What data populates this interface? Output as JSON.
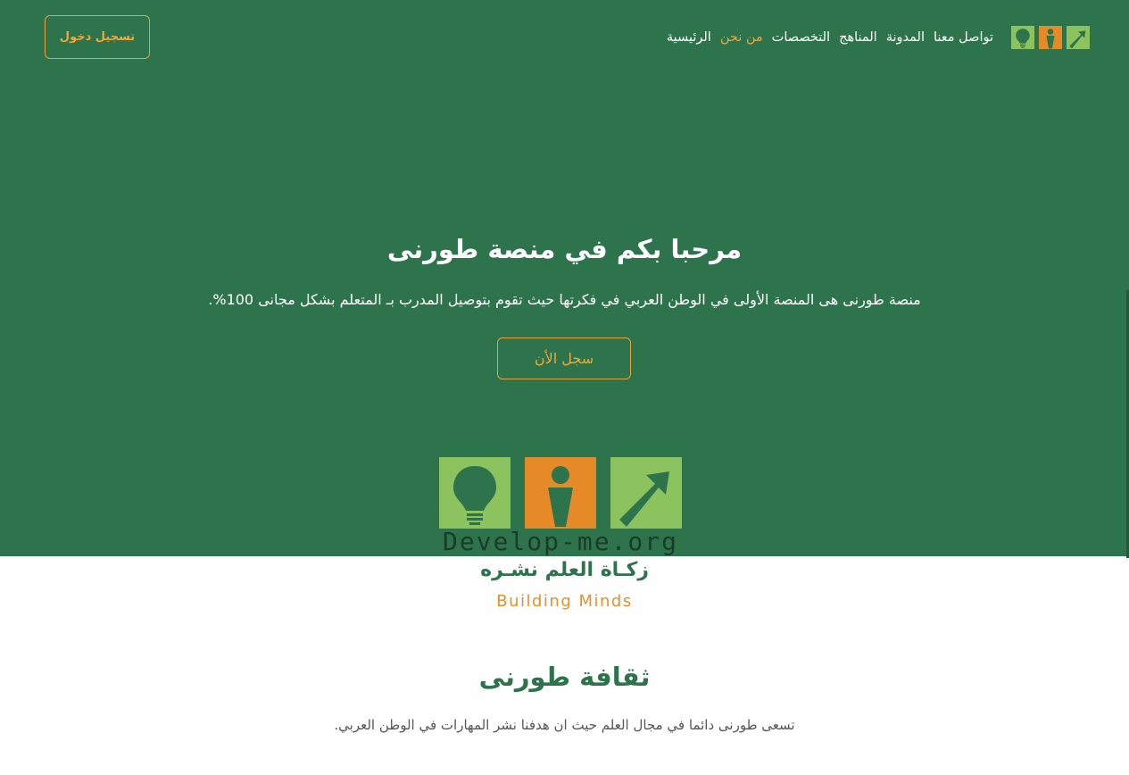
{
  "header": {
    "login_label": "تسجيل دخول",
    "nav": [
      {
        "label": "الرئيسية",
        "active": false
      },
      {
        "label": "من نحن",
        "active": true
      },
      {
        "label": "التخصصات",
        "active": false
      },
      {
        "label": "المناهج",
        "active": false
      },
      {
        "label": "المدونة",
        "active": false
      },
      {
        "label": "تواصل معنا",
        "active": false
      }
    ],
    "logo_icons": [
      "lightbulb-icon",
      "person-icon",
      "arrow-up-right-icon"
    ]
  },
  "hero": {
    "title": "مرحبا بكم في منصة طورنى",
    "subtitle": "منصة طورنى هى المنصة الأولى في الوطن العربي في فكرتها حيث تقوم بتوصيل المدرب بـ المتعلم بشكل مجانى 100%.",
    "cta_label": "سجل الأن"
  },
  "brand": {
    "logo_text": "Develop-me.org",
    "tagline_ar": "زكـاة العلم نشـره",
    "tagline_en": "Building Minds"
  },
  "culture": {
    "title": "ثقافة طورنى",
    "subtitle": "تسعى طورنى دائما في مجال العلم حيث ان هدفنا نشر المهارات في الوطن العربي."
  },
  "colors": {
    "primary_green": "#2d744d",
    "accent_orange": "#f0a93a",
    "logo_light_green": "#8dc35f",
    "logo_orange": "#e58a27"
  }
}
